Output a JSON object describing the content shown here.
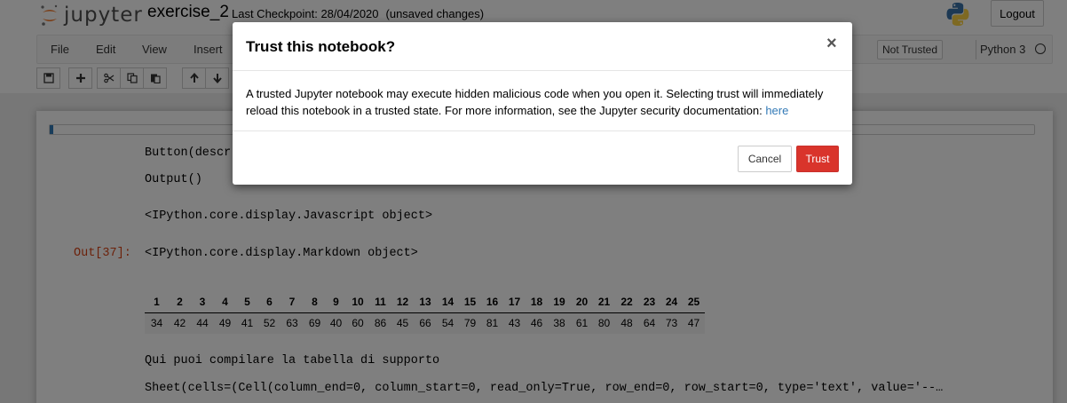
{
  "header": {
    "logo_text": "jupyter",
    "notebook_name": "exercise_2",
    "checkpoint": "Last Checkpoint: 28/04/2020",
    "unsaved": "(unsaved changes)",
    "logout_label": "Logout"
  },
  "menubar": {
    "items": [
      {
        "label": "File"
      },
      {
        "label": "Edit"
      },
      {
        "label": "View"
      },
      {
        "label": "Insert"
      }
    ],
    "trust_status": "Not Trusted",
    "kernel_name": "Python 3"
  },
  "toolbar": {
    "buttons": [
      "save-icon",
      "plus-icon",
      "cut-icon",
      "copy-icon",
      "paste-icon",
      "arrow-up-icon",
      "arrow-down-icon"
    ]
  },
  "notebook": {
    "progress_fraction": 0.004,
    "outputs": [
      "Button(descr",
      "Output()",
      "<IPython.core.display.Javascript object>",
      "<IPython.core.display.Markdown object>",
      "Qui puoi compilare la tabella di supporto",
      "Sheet(cells=(Cell(column_end=0, column_start=0, read_only=True, row_end=0, row_start=0, type='text', value='--…"
    ],
    "out_prompt": "Out[37]:",
    "table": {
      "headers": [
        "1",
        "2",
        "3",
        "4",
        "5",
        "6",
        "7",
        "8",
        "9",
        "10",
        "11",
        "12",
        "13",
        "14",
        "15",
        "16",
        "17",
        "18",
        "19",
        "20",
        "21",
        "22",
        "23",
        "24",
        "25"
      ],
      "values": [
        "34",
        "42",
        "44",
        "49",
        "41",
        "52",
        "63",
        "69",
        "40",
        "60",
        "86",
        "45",
        "66",
        "54",
        "79",
        "81",
        "43",
        "46",
        "38",
        "61",
        "80",
        "48",
        "64",
        "73",
        "47"
      ]
    }
  },
  "modal": {
    "title": "Trust this notebook?",
    "close_symbol": "×",
    "body_line1": "A trusted Jupyter notebook may execute hidden malicious code when you open it. Selecting trust will immediately",
    "body_line2": "reload this notebook in a trusted state. For more information, see the Jupyter security documentation: ",
    "link_text": "here",
    "cancel_label": "Cancel",
    "trust_label": "Trust"
  },
  "colors": {
    "trust_button": "#d9342b",
    "link": "#337ab7",
    "out_prompt": "#d84315",
    "jupyter_orange": "#f37626"
  }
}
